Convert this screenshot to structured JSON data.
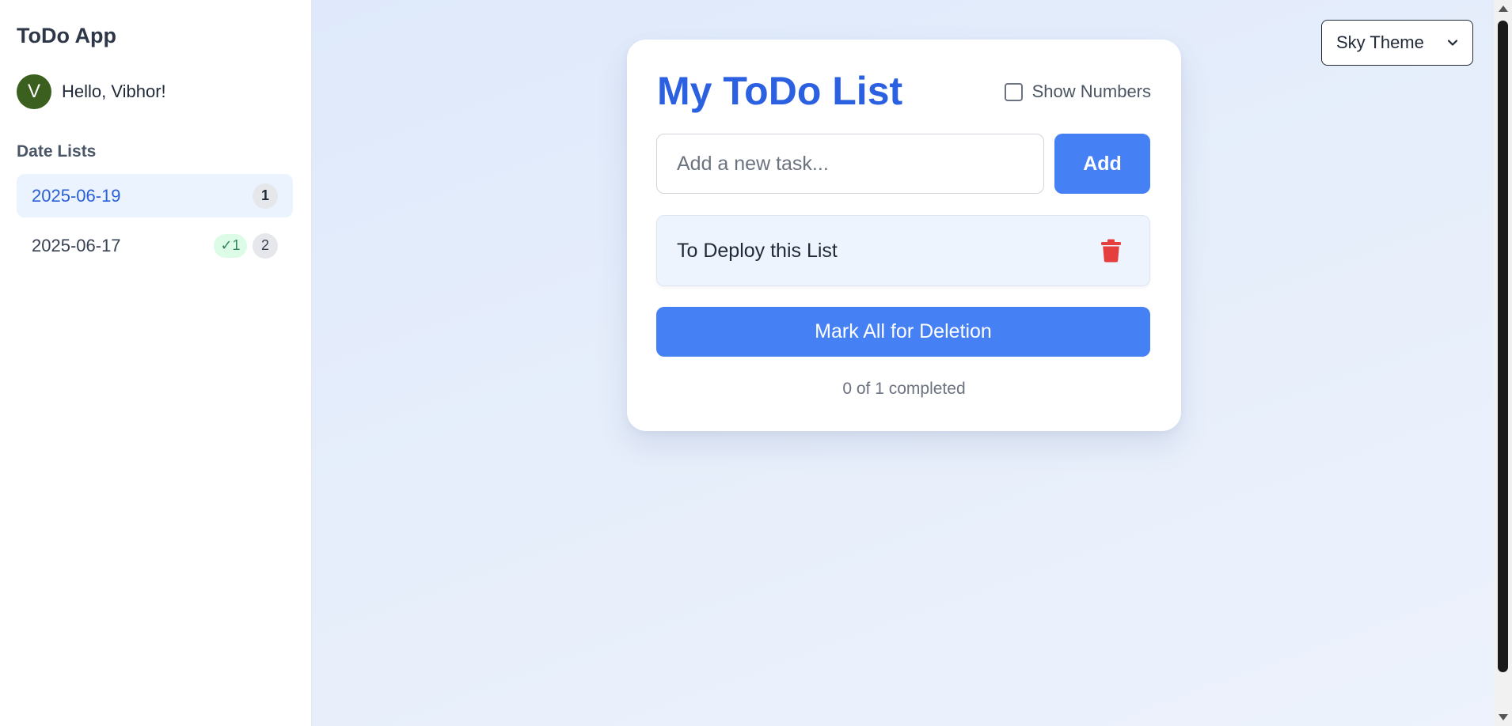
{
  "sidebar": {
    "app_title": "ToDo App",
    "user": {
      "avatar_initial": "V",
      "greeting": "Hello, Vibhor!",
      "avatar_color": "#3a5f1f"
    },
    "section_title": "Date Lists",
    "date_lists": [
      {
        "date": "2025-06-19",
        "active": true,
        "completed_badge": null,
        "count": "1"
      },
      {
        "date": "2025-06-17",
        "active": false,
        "completed_badge": "✓1",
        "count": "2"
      }
    ]
  },
  "theme_select": {
    "selected": "Sky Theme",
    "icon": "chevron-down-icon"
  },
  "card": {
    "title": "My ToDo List",
    "show_numbers_label": "Show Numbers",
    "show_numbers_checked": false,
    "input_placeholder": "Add a new task...",
    "add_label": "Add",
    "tasks": [
      {
        "text": "To Deploy this List",
        "delete_icon": "trash-icon"
      }
    ],
    "mark_all_label": "Mark All for Deletion",
    "progress_text": "0 of 1 completed"
  },
  "colors": {
    "accent": "#4580f5",
    "title": "#2b60e0",
    "delete": "#e53e3e",
    "active_item_bg": "#ebf3fe"
  }
}
